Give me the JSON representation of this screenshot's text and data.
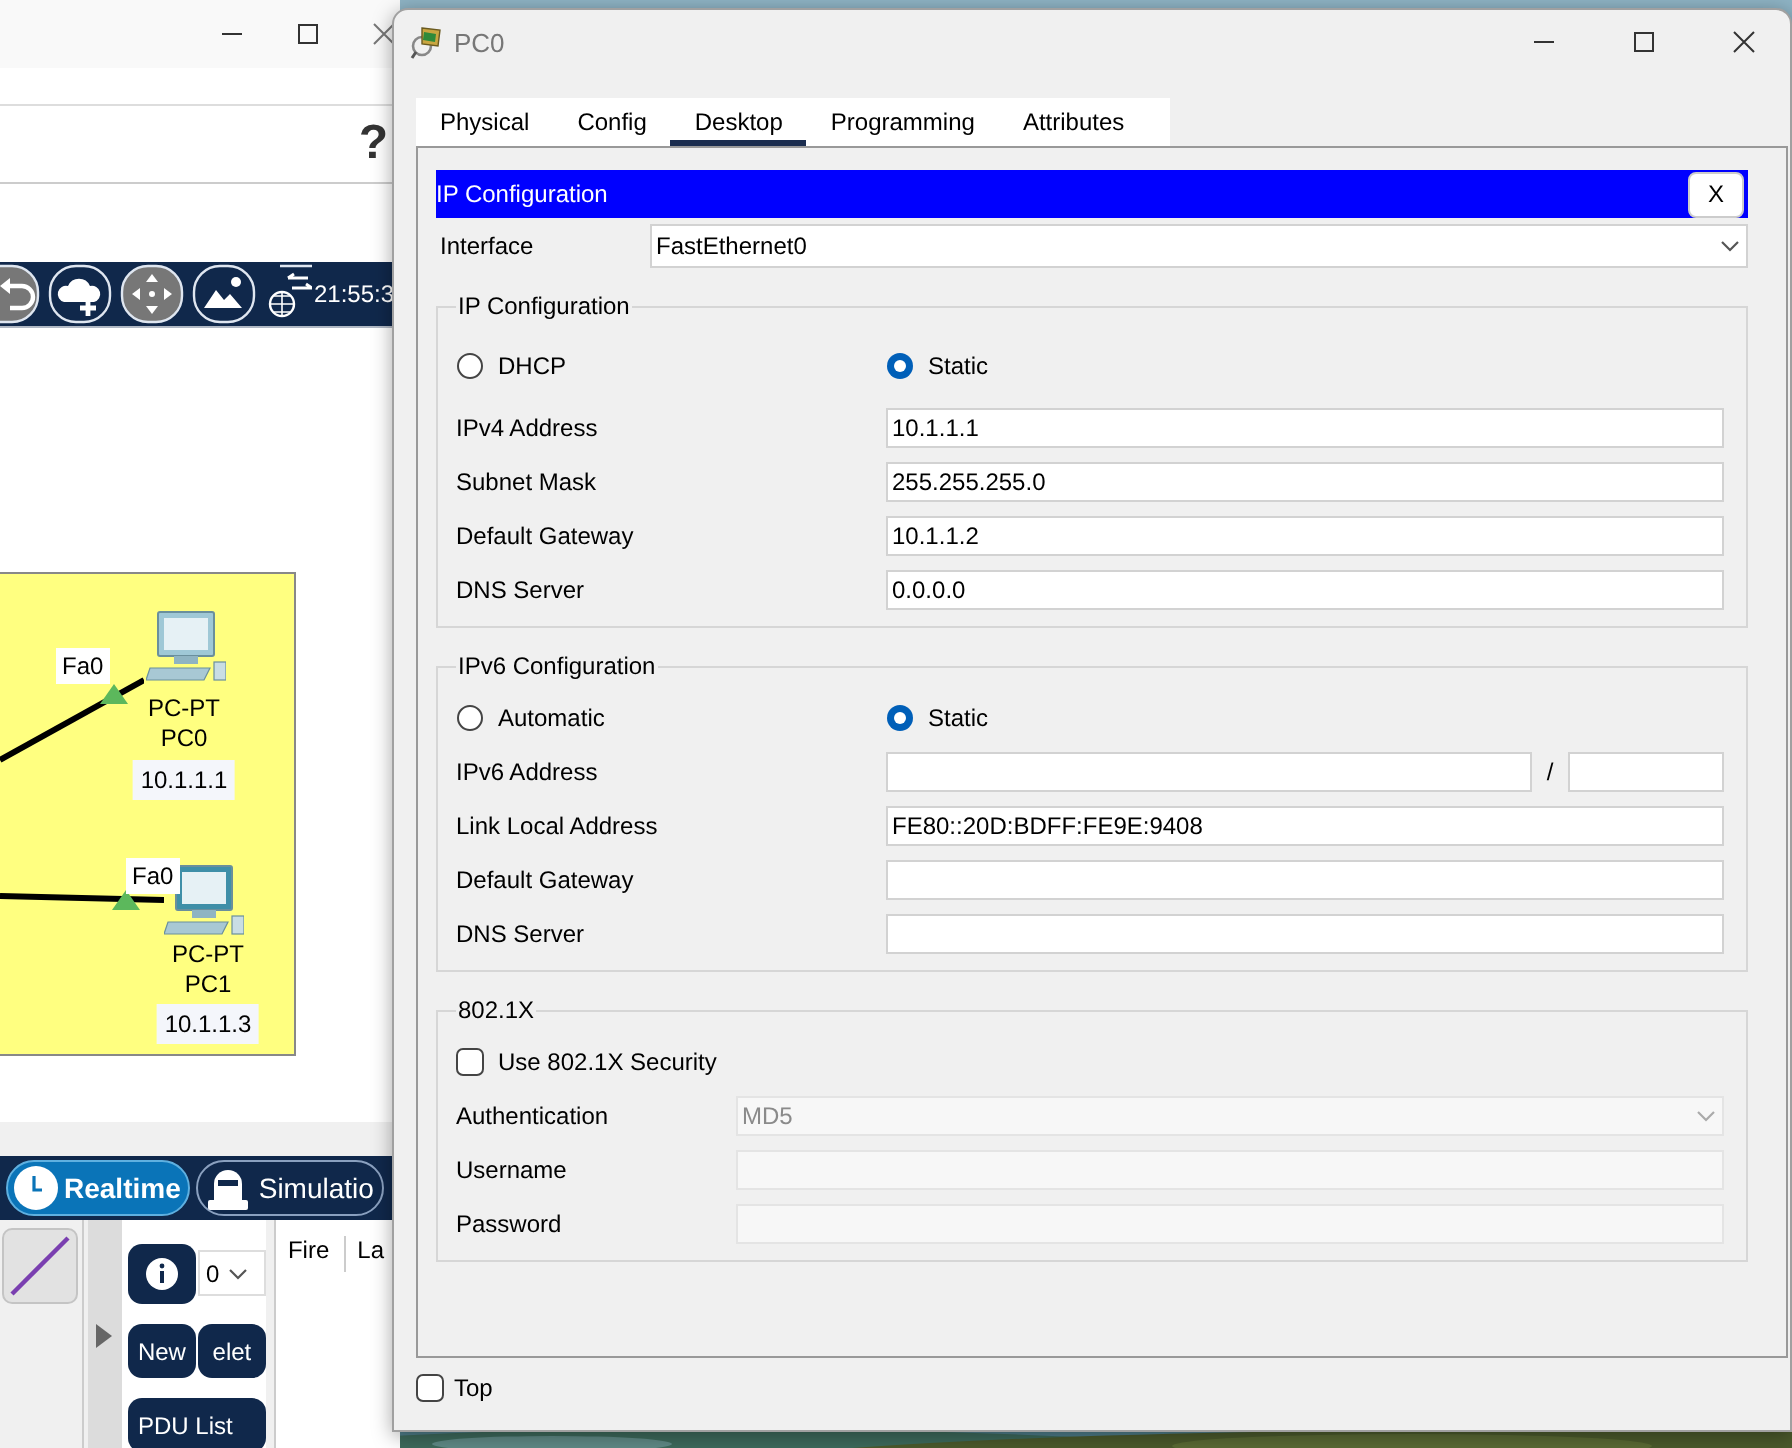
{
  "workspace": {
    "help_mark": "?",
    "clock": "21:55:3",
    "devices": [
      {
        "port": "Fa0",
        "model": "PC-PT",
        "name": "PC0",
        "address": "10.1.1.1"
      },
      {
        "port": "Fa0",
        "model": "PC-PT",
        "name": "PC1",
        "address": "10.1.1.3"
      }
    ],
    "mode_buttons": [
      {
        "label": "Realtime",
        "selected": true
      },
      {
        "label": "Simulatio",
        "selected": false
      }
    ],
    "scenario": "0",
    "pdu_buttons": [
      "New",
      "elet",
      "PDU List"
    ],
    "pdu_columns": [
      "Fire",
      "La"
    ]
  },
  "dialog": {
    "title": "PC0",
    "tabs": [
      {
        "label": "Physical",
        "selected": false
      },
      {
        "label": "Config",
        "selected": false
      },
      {
        "label": "Desktop",
        "selected": true
      },
      {
        "label": "Programming",
        "selected": false
      },
      {
        "label": "Attributes",
        "selected": false
      }
    ],
    "app": {
      "title": "IP Configuration",
      "close": "X",
      "interface": {
        "label": "Interface",
        "value": "FastEthernet0"
      },
      "groups": [
        {
          "title": "IP Configuration",
          "modes": [
            {
              "label": "DHCP",
              "selected": false
            },
            {
              "label": "Static",
              "selected": true
            }
          ],
          "fields": [
            {
              "label": "IPv4 Address",
              "value": "10.1.1.1"
            },
            {
              "label": "Subnet Mask",
              "value": "255.255.255.0"
            },
            {
              "label": "Default Gateway",
              "value": "10.1.1.2"
            },
            {
              "label": "DNS Server",
              "value": "0.0.0.0"
            }
          ]
        },
        {
          "title": "IPv6 Configuration",
          "modes": [
            {
              "label": "Automatic",
              "selected": false
            },
            {
              "label": "Static",
              "selected": true
            }
          ],
          "fields": [
            {
              "label": "IPv6 Address",
              "separator": "/"
            },
            {
              "label": "Link Local Address",
              "value": "FE80::20D:BDFF:FE9E:9408"
            },
            {
              "label": "Default Gateway"
            },
            {
              "label": "DNS Server"
            }
          ]
        },
        {
          "title": "802.1X",
          "option": {
            "label": "Use 802.1X Security",
            "checked": false
          },
          "fields": [
            {
              "label": "Authentication",
              "kind": "select",
              "value": "MD5",
              "disabled": true
            },
            {
              "label": "Username",
              "kind": "text",
              "disabled": true
            },
            {
              "label": "Password",
              "kind": "text",
              "disabled": true
            }
          ]
        }
      ]
    },
    "top": {
      "label": "Top",
      "checked": false
    }
  }
}
